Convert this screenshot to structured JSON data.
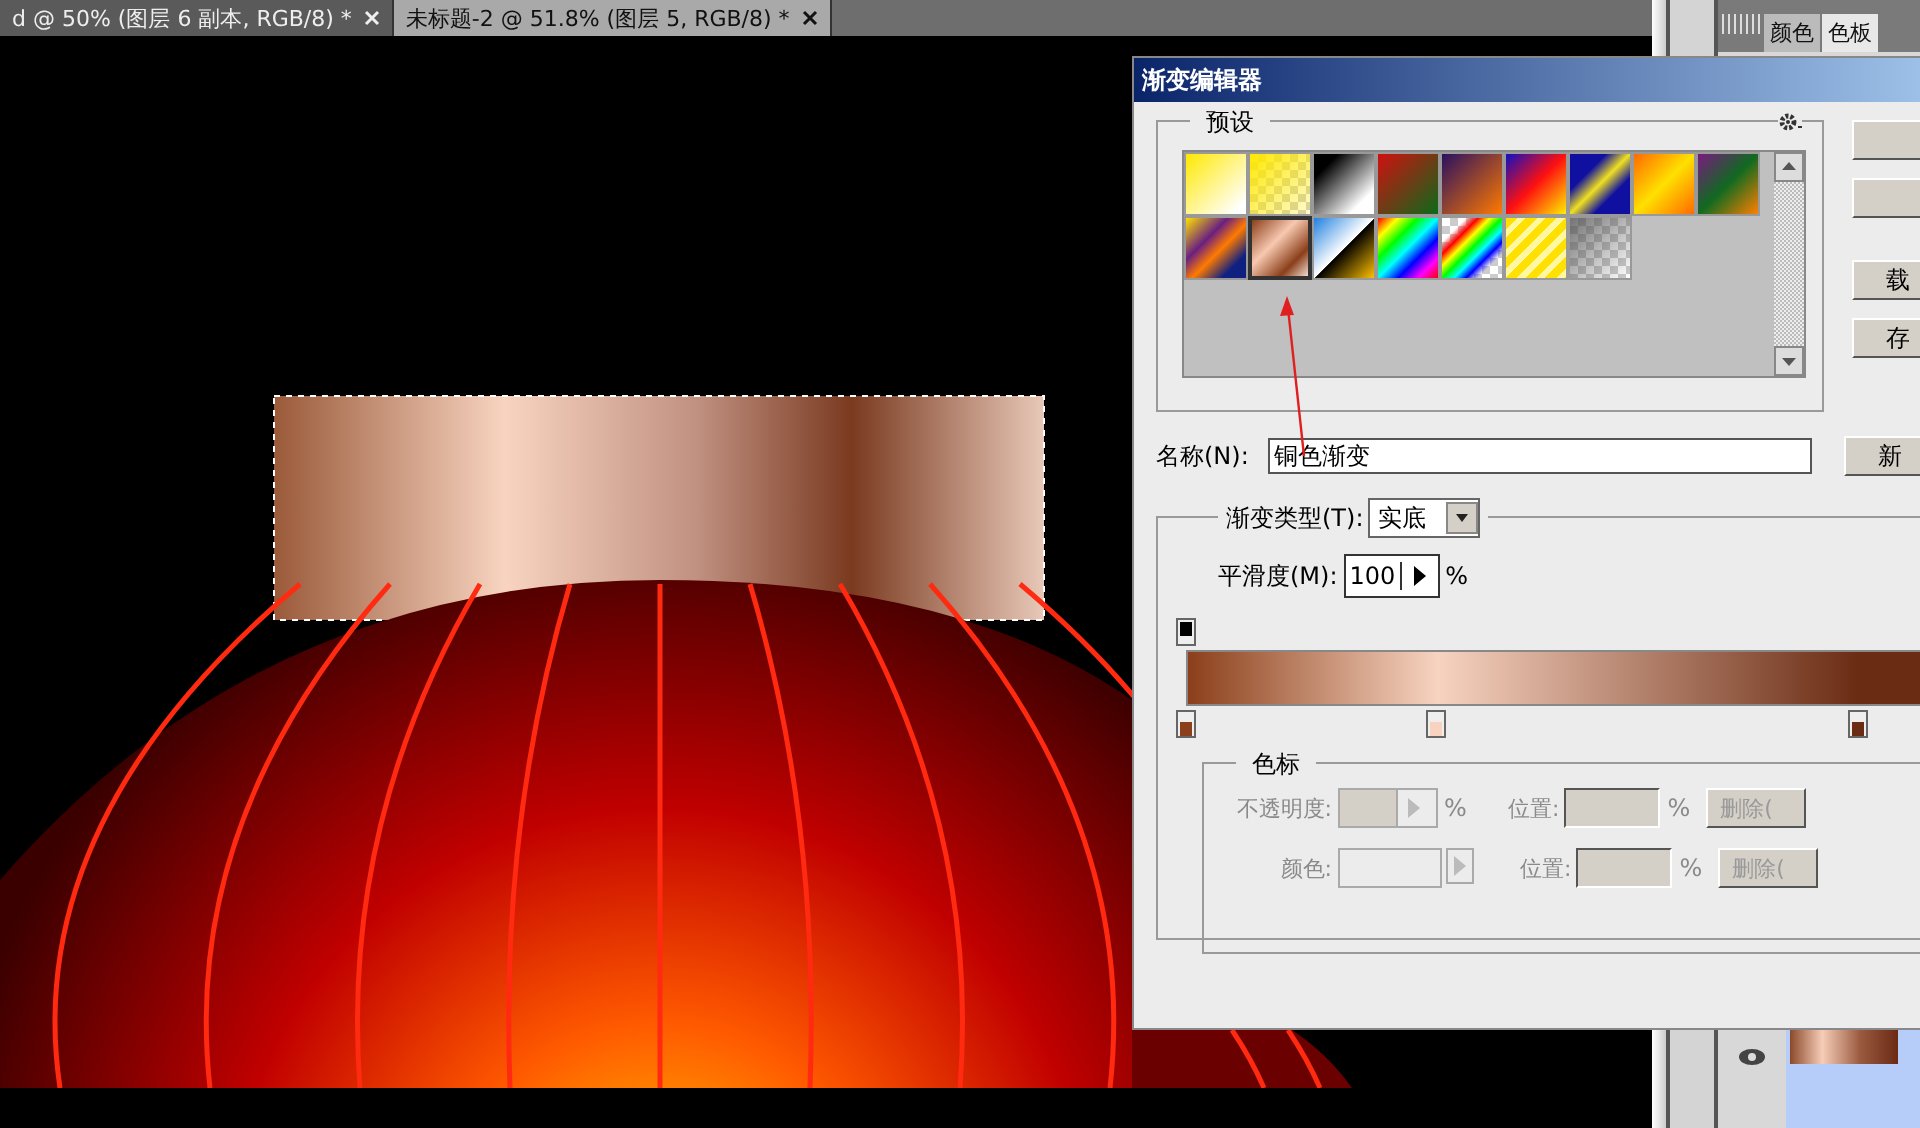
{
  "doc_tabs": [
    {
      "label": "d @ 50% (图层 6 副本, RGB/8) *",
      "selected": false
    },
    {
      "label": "未标题-2 @ 51.8% (图层 5, RGB/8) *",
      "selected": true
    }
  ],
  "panel_tabs": [
    {
      "label": "颜色",
      "selected": false
    },
    {
      "label": "色板",
      "selected": true
    }
  ],
  "dialog": {
    "title": "渐变编辑器",
    "presets_label": "预设",
    "presets": [
      {
        "selected": false
      },
      {
        "selected": false
      },
      {
        "selected": false
      },
      {
        "selected": false
      },
      {
        "selected": false
      },
      {
        "selected": false
      },
      {
        "selected": false
      },
      {
        "selected": false
      },
      {
        "selected": false
      },
      {
        "selected": false
      },
      {
        "selected": true
      },
      {
        "selected": false
      },
      {
        "selected": false
      },
      {
        "selected": false
      },
      {
        "selected": false
      },
      {
        "selected": false
      }
    ],
    "side_buttons": [
      "载",
      "存"
    ],
    "name_label": "名称(N):",
    "name_value": "铜色渐变",
    "new_button": "新",
    "type_label": "渐变类型(T):",
    "type_value": "实底",
    "smooth_label": "平滑度(M):",
    "smooth_value": "100",
    "smooth_unit": "%",
    "opacity_stops": [
      {
        "color": "#000000"
      }
    ],
    "color_stops": [
      {
        "color": "#8b3f1a"
      },
      {
        "color": "#f7d3c0"
      },
      {
        "color": "#6b2c14"
      }
    ],
    "stops_group": {
      "label": "色标",
      "rows": [
        {
          "label": "不透明度:",
          "unit": "%",
          "pos_label": "位置:",
          "pos_unit": "%",
          "delete": "删除(",
          "kind": "opacity"
        },
        {
          "label": "颜色:",
          "pos_label": "位置:",
          "pos_unit": "%",
          "delete": "删除(",
          "kind": "color"
        }
      ]
    }
  }
}
